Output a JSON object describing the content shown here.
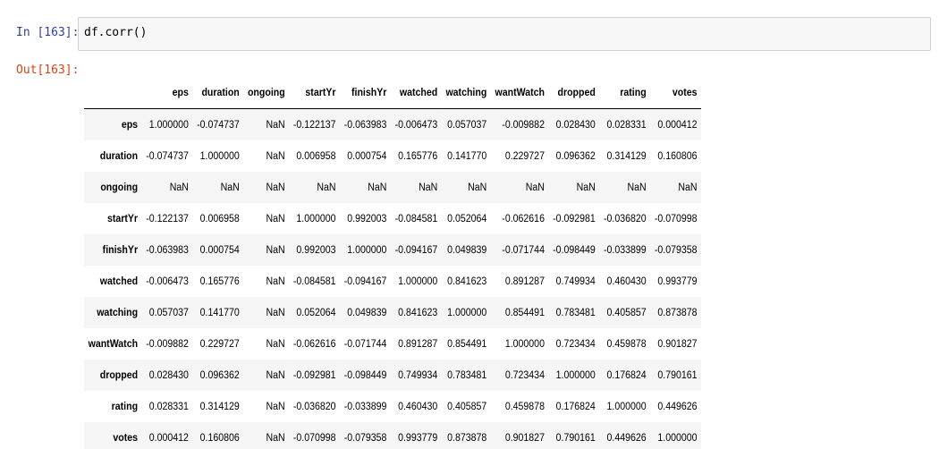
{
  "cell": {
    "in_prompt": "In [163]:",
    "code": "df.corr()",
    "out_prompt": "Out[163]:"
  },
  "table": {
    "columns": [
      "eps",
      "duration",
      "ongoing",
      "startYr",
      "finishYr",
      "watched",
      "watching",
      "wantWatch",
      "dropped",
      "rating",
      "votes"
    ],
    "rows": [
      {
        "label": "eps",
        "values": [
          "1.000000",
          "-0.074737",
          "NaN",
          "-0.122137",
          "-0.063983",
          "-0.006473",
          "0.057037",
          "-0.009882",
          "0.028430",
          "0.028331",
          "0.000412"
        ]
      },
      {
        "label": "duration",
        "values": [
          "-0.074737",
          "1.000000",
          "NaN",
          "0.006958",
          "0.000754",
          "0.165776",
          "0.141770",
          "0.229727",
          "0.096362",
          "0.314129",
          "0.160806"
        ]
      },
      {
        "label": "ongoing",
        "values": [
          "NaN",
          "NaN",
          "NaN",
          "NaN",
          "NaN",
          "NaN",
          "NaN",
          "NaN",
          "NaN",
          "NaN",
          "NaN"
        ]
      },
      {
        "label": "startYr",
        "values": [
          "-0.122137",
          "0.006958",
          "NaN",
          "1.000000",
          "0.992003",
          "-0.084581",
          "0.052064",
          "-0.062616",
          "-0.092981",
          "-0.036820",
          "-0.070998"
        ]
      },
      {
        "label": "finishYr",
        "values": [
          "-0.063983",
          "0.000754",
          "NaN",
          "0.992003",
          "1.000000",
          "-0.094167",
          "0.049839",
          "-0.071744",
          "-0.098449",
          "-0.033899",
          "-0.079358"
        ]
      },
      {
        "label": "watched",
        "values": [
          "-0.006473",
          "0.165776",
          "NaN",
          "-0.084581",
          "-0.094167",
          "1.000000",
          "0.841623",
          "0.891287",
          "0.749934",
          "0.460430",
          "0.993779"
        ]
      },
      {
        "label": "watching",
        "values": [
          "0.057037",
          "0.141770",
          "NaN",
          "0.052064",
          "0.049839",
          "0.841623",
          "1.000000",
          "0.854491",
          "0.783481",
          "0.405857",
          "0.873878"
        ]
      },
      {
        "label": "wantWatch",
        "values": [
          "-0.009882",
          "0.229727",
          "NaN",
          "-0.062616",
          "-0.071744",
          "0.891287",
          "0.854491",
          "1.000000",
          "0.723434",
          "0.459878",
          "0.901827"
        ]
      },
      {
        "label": "dropped",
        "values": [
          "0.028430",
          "0.096362",
          "NaN",
          "-0.092981",
          "-0.098449",
          "0.749934",
          "0.783481",
          "0.723434",
          "1.000000",
          "0.176824",
          "0.790161"
        ]
      },
      {
        "label": "rating",
        "values": [
          "0.028331",
          "0.314129",
          "NaN",
          "-0.036820",
          "-0.033899",
          "0.460430",
          "0.405857",
          "0.459878",
          "0.176824",
          "1.000000",
          "0.449626"
        ]
      },
      {
        "label": "votes",
        "values": [
          "0.000412",
          "0.160806",
          "NaN",
          "-0.070998",
          "-0.079358",
          "0.993779",
          "0.873878",
          "0.901827",
          "0.790161",
          "0.449626",
          "1.000000"
        ]
      }
    ]
  }
}
